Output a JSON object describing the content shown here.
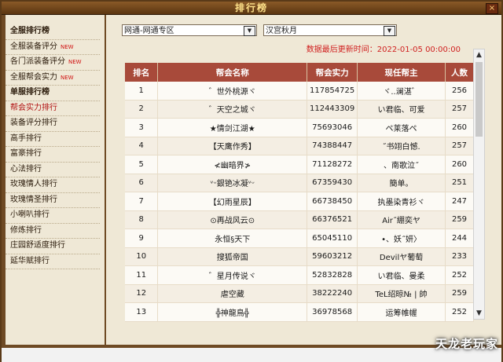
{
  "window": {
    "title": "排行榜",
    "close_glyph": "×"
  },
  "sidebar": {
    "items": [
      {
        "label": "全服排行榜",
        "type": "header"
      },
      {
        "label": "全服装备评分",
        "new": "NEW"
      },
      {
        "label": "各门派装备评分",
        "new": "NEW"
      },
      {
        "label": "全服帮会实力",
        "new": "NEW"
      },
      {
        "label": "单服排行榜",
        "type": "header"
      },
      {
        "label": "帮会实力排行",
        "active": true
      },
      {
        "label": "装备评分排行"
      },
      {
        "label": "高手排行"
      },
      {
        "label": "富豪排行"
      },
      {
        "label": "心法排行"
      },
      {
        "label": "玫瑰情人排行"
      },
      {
        "label": "玫瑰情圣排行"
      },
      {
        "label": "小喇叭排行"
      },
      {
        "label": "修炼排行"
      },
      {
        "label": "庄园舒适度排行"
      },
      {
        "label": "延华赋排行"
      }
    ]
  },
  "filters": {
    "region": "网通-网通专区",
    "server": "汉宫秋月",
    "updated": "数据最后更新时间：2022-01-05 00:00:00"
  },
  "table": {
    "headers": [
      "排名",
      "帮会名称",
      "帮会实力",
      "现任帮主",
      "人数"
    ],
    "rows": [
      [
        "1",
        "゛世外桃源ヾ",
        "117854725",
        "ヾ..澜湛゛",
        "256"
      ],
      [
        "2",
        "゛天空之城ヾ",
        "112443309",
        "い君临、可爱",
        "257"
      ],
      [
        "3",
        "★情剑江湖★",
        "75693046",
        "ペ莱落ペ",
        "260"
      ],
      [
        "4",
        "【天鹰作秀】",
        "74388447",
        "˝书翊白憾.",
        "257"
      ],
      [
        "5",
        "≮幽暗界≯",
        "71128272",
        "、南歌泣˝",
        "260"
      ],
      [
        "6",
        "ᵛᵕ銀铯冰凝ᵛᵕ",
        "67359430",
        "簡单。",
        "251"
      ],
      [
        "7",
        "【幻雨星辰】",
        "66738450",
        "执墨染青衫ヾ",
        "247"
      ],
      [
        "8",
        "⊙再战风云⊙",
        "66376521",
        "Air˝綳奕ヤ",
        "259"
      ],
      [
        "9",
        "永恒§天下",
        "65045110",
        "•、妖˝妍〉",
        "244"
      ],
      [
        "10",
        "搜狐帝国",
        "59603212",
        "Devilヤ葡萄",
        "233"
      ],
      [
        "11",
        "゛星月传说ヾ",
        "52832828",
        "い君临、曼柔",
        "252"
      ],
      [
        "12",
        "虐空藏",
        "38222240",
        "TeL绍晾№ | 帥",
        "259"
      ],
      [
        "13",
        "╬神龍鳥╬",
        "36978568",
        "运筹帷幄",
        "252"
      ]
    ]
  },
  "scrollbar": {
    "up": "▲",
    "down": "▼"
  },
  "dropdown_arrow": "▼",
  "watermark": "天龙老玩家"
}
